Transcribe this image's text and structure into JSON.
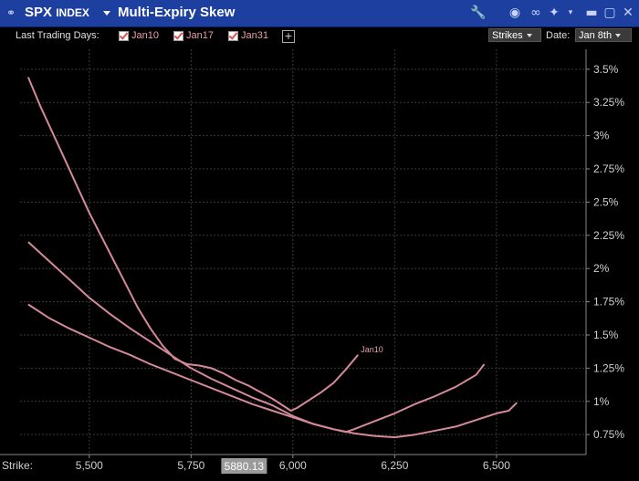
{
  "titlebar": {
    "ticker": "SPX",
    "ticker_suffix": "INDEX",
    "title": "Multi-Expiry Skew"
  },
  "toolbar": {
    "last_trading_days_label": "Last Trading Days:",
    "expiries": [
      "Jan10",
      "Jan17",
      "Jan31"
    ],
    "add_label": "+",
    "mode_dropdown": "Strikes",
    "date_label": "Date:",
    "date_dropdown": "Jan 8th"
  },
  "colors": {
    "series": "#d48a98",
    "grid": "#3a3a3a",
    "title_bg": "#1c3fa0",
    "spot_bg": "#9a9a9a"
  },
  "icons": [
    "link-icon",
    "wrench-icon",
    "search-icon",
    "chain-icon",
    "pin-icon",
    "star-icon",
    "minimize-icon",
    "maximize-icon",
    "close-icon"
  ],
  "chart_data": {
    "type": "line",
    "xlabel": "Strike:",
    "spot_label": "5880.13",
    "spot": 5880.13,
    "xlim": [
      5330,
      6720
    ],
    "ylim": [
      0.006,
      0.0365
    ],
    "x_ticks": [
      5500,
      5750,
      6000,
      6250,
      6500
    ],
    "x_tick_labels": [
      "5,500",
      "5,750",
      "6,000",
      "6,250",
      "6,500"
    ],
    "y_ticks": [
      0.0075,
      0.01,
      0.0125,
      0.015,
      0.0175,
      0.02,
      0.0225,
      0.025,
      0.0275,
      0.03,
      0.0325,
      0.035
    ],
    "y_tick_labels": [
      "0.75%",
      "1%",
      "1.25%",
      "1.5%",
      "1.75%",
      "2%",
      "2.25%",
      "2.5%",
      "2.75%",
      "3%",
      "3.25%",
      "3.5%"
    ],
    "grid": true,
    "series": [
      {
        "name": "Jan10",
        "x": [
          5350,
          5380,
          5410,
          5440,
          5470,
          5500,
          5530,
          5560,
          5590,
          5620,
          5650,
          5680,
          5710,
          5740,
          5770,
          5800,
          5830,
          5860,
          5890,
          5920,
          5950,
          5980,
          5995,
          6010,
          6040,
          6070,
          6100,
          6130,
          6160
        ],
        "y": [
          0.0344,
          0.0322,
          0.0302,
          0.0282,
          0.0262,
          0.0242,
          0.0224,
          0.0206,
          0.0188,
          0.017,
          0.0155,
          0.0142,
          0.0132,
          0.0128,
          0.0127,
          0.0125,
          0.0121,
          0.0116,
          0.0112,
          0.0107,
          0.0102,
          0.0096,
          0.0093,
          0.0095,
          0.0101,
          0.0107,
          0.0114,
          0.0124,
          0.0135
        ]
      },
      {
        "name": "Jan17",
        "x": [
          5350,
          5400,
          5450,
          5500,
          5550,
          5600,
          5650,
          5700,
          5750,
          5800,
          5850,
          5900,
          5950,
          6000,
          6050,
          6100,
          6130,
          6150,
          6200,
          6250,
          6300,
          6350,
          6400,
          6450,
          6470
        ],
        "y": [
          0.022,
          0.0206,
          0.0192,
          0.0178,
          0.0166,
          0.0155,
          0.0145,
          0.0135,
          0.0125,
          0.0117,
          0.011,
          0.0103,
          0.0097,
          0.0089,
          0.0083,
          0.0079,
          0.0077,
          0.0079,
          0.0085,
          0.0091,
          0.0098,
          0.0104,
          0.0111,
          0.012,
          0.0128
        ]
      },
      {
        "name": "Jan31",
        "x": [
          5350,
          5400,
          5450,
          5500,
          5550,
          5600,
          5650,
          5700,
          5750,
          5800,
          5850,
          5900,
          5950,
          6000,
          6050,
          6100,
          6150,
          6200,
          6250,
          6300,
          6350,
          6400,
          6450,
          6500,
          6530,
          6550
        ],
        "y": [
          0.0173,
          0.0163,
          0.0155,
          0.0148,
          0.0141,
          0.0135,
          0.0128,
          0.0122,
          0.0116,
          0.011,
          0.0104,
          0.0098,
          0.0093,
          0.0088,
          0.0083,
          0.0079,
          0.0076,
          0.0074,
          0.0073,
          0.0075,
          0.0078,
          0.0081,
          0.0086,
          0.0091,
          0.0093,
          0.0099
        ]
      }
    ],
    "annotations": [
      {
        "series": "Jan10",
        "text": "Jan10"
      }
    ]
  }
}
